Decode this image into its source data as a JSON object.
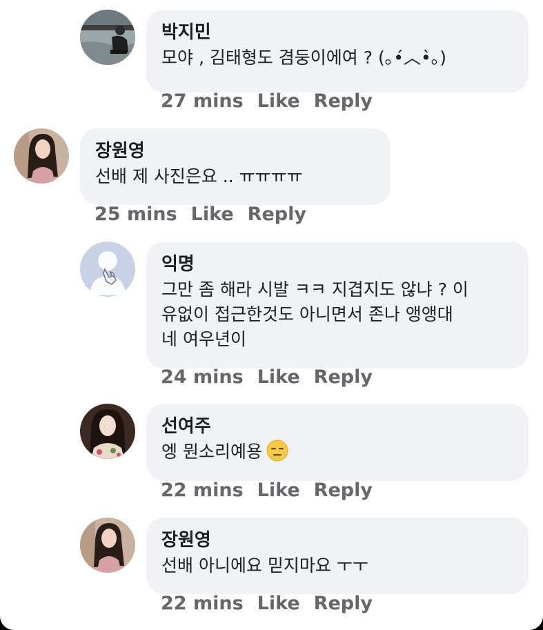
{
  "comments": [
    {
      "author": "박지민",
      "text_lines": [
        "모야 , 김태형도 겸둥이에여 ? (｡•́︿•̀｡)"
      ],
      "time": "27 mins",
      "like": "Like",
      "reply": "Reply",
      "avatar": "photo-man-by-water"
    },
    {
      "author": "장원영",
      "text_lines": [
        "선배 제 사진은요 .. ㅠㅠㅠㅠ"
      ],
      "time": "25 mins",
      "like": "Like",
      "reply": "Reply",
      "avatar": "photo-woman-long-hair"
    },
    {
      "author": "익명",
      "text_lines": [
        "그만 좀 해라 시발 ㅋㅋ 지겹지도 않냐 ? 이",
        "유없이 접근한것도 아니면서 존나 앵앵대",
        "네 여우년이"
      ],
      "time": "24 mins",
      "like": "Like",
      "reply": "Reply",
      "avatar": "default-avatar-hand-icon"
    },
    {
      "author": "선여주",
      "text_lines": [
        "엥 뭔소리예용"
      ],
      "emoji": "expressionless-face-emoji",
      "time": "22 mins",
      "like": "Like",
      "reply": "Reply",
      "avatar": "photo-woman-floral"
    },
    {
      "author": "장원영",
      "text_lines": [
        "선배 아니에요 믿지마요 ㅜㅜ"
      ],
      "time": "22 mins",
      "like": "Like",
      "reply": "Reply",
      "avatar": "photo-woman-long-hair"
    }
  ],
  "colors": {
    "bubble": "#f0f2f5",
    "text": "#1c1e21",
    "meta": "#65676b"
  }
}
